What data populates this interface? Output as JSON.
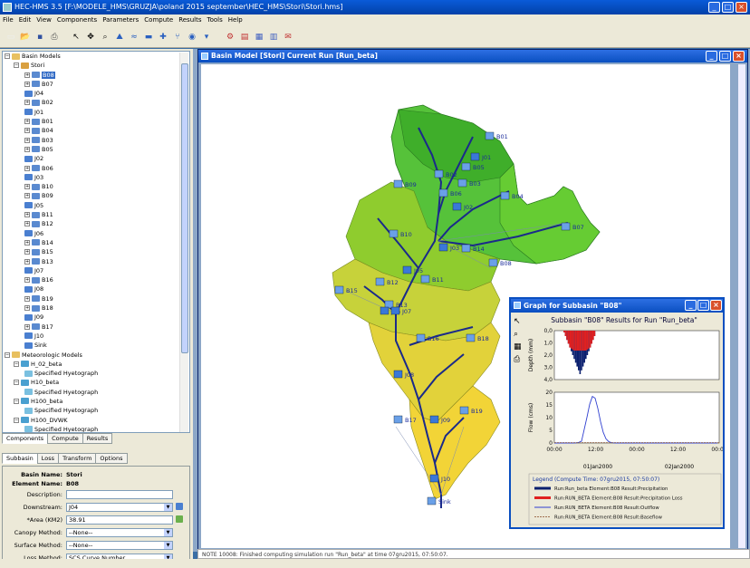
{
  "window": {
    "title": "HEC-HMS 3.5 [F:\\MODELE_HMS\\GRUZJA\\poland 2015 september\\HEC_HMS\\Stori\\Stori.hms]"
  },
  "menu": [
    "File",
    "Edit",
    "View",
    "Components",
    "Parameters",
    "Compute",
    "Results",
    "Tools",
    "Help"
  ],
  "toolbar_icons": [
    "new-icon",
    "open-icon",
    "save-icon",
    "print-icon",
    "arrow-icon",
    "pan-icon",
    "zoom-icon",
    "subbasin-icon",
    "reach-icon",
    "reservoir-icon",
    "junction-icon",
    "diversion-icon",
    "source-icon",
    "sink-icon",
    "compute-icon",
    "graph-icon",
    "summary-icon",
    "table-icon",
    "message-icon"
  ],
  "tree": {
    "root": "Basin Models",
    "basin": "Stori",
    "elements": [
      "B08",
      "B07",
      "J04",
      "B02",
      "J01",
      "B01",
      "B04",
      "B03",
      "B05",
      "J02",
      "B06",
      "J03",
      "B10",
      "B09",
      "J05",
      "B11",
      "B12",
      "J06",
      "B14",
      "B15",
      "B13",
      "J07",
      "B16",
      "J08",
      "B19",
      "B18",
      "J09",
      "B17",
      "J10",
      "Sink"
    ],
    "met_root": "Meteorologic Models",
    "met": [
      {
        "name": "H_02_beta",
        "child": "Specified Hyetograph"
      },
      {
        "name": "H10_beta",
        "child": "Specified Hyetograph"
      },
      {
        "name": "H100_beta",
        "child": "Specified Hyetograph"
      },
      {
        "name": "H100_DVWK",
        "child": "Specified Hyetograph"
      }
    ]
  },
  "left_tabs": [
    "Components",
    "Compute",
    "Results"
  ],
  "prop_tabs": [
    "Subbasin",
    "Loss",
    "Transform",
    "Options"
  ],
  "props": {
    "basin_name_label": "Basin Name:",
    "basin_name": "Stori",
    "element_name_label": "Element Name:",
    "element_name": "B08",
    "description_label": "Description:",
    "description": "",
    "downstream_label": "Downstream:",
    "downstream": "J04",
    "area_label": "*Area (KM2)",
    "area": "38.91",
    "canopy_label": "Canopy Method:",
    "canopy": "--None--",
    "surface_label": "Surface Method:",
    "surface": "--None--",
    "loss_label": "Loss Method:",
    "loss": "SCS Curve Number"
  },
  "basin_window": {
    "title": "Basin Model [Stori]  Current Run [Run_beta]"
  },
  "map_labels": [
    "B01",
    "B02",
    "B03",
    "J01",
    "B04",
    "B05",
    "B06",
    "J02",
    "B07",
    "B08",
    "B09",
    "B10",
    "J03",
    "B11",
    "J05",
    "B12",
    "B13",
    "B14",
    "B15",
    "J06",
    "J07",
    "B16",
    "B18",
    "J08",
    "B17",
    "J09",
    "B19",
    "J10",
    "Sink"
  ],
  "graph": {
    "title": "Graph for Subbasin \"B08\"",
    "plot_title": "Subbasin \"B08\" Results for Run \"Run_beta\"",
    "depth_label": "Depth (mm)",
    "flow_label": "Flow (cms)",
    "depth_ticks": [
      "0,0",
      "1,0",
      "2,0",
      "3,0",
      "4,0"
    ],
    "flow_ticks": [
      "0",
      "5",
      "10",
      "15",
      "20"
    ],
    "time_ticks": [
      "00:00",
      "12:00",
      "00:00",
      "12:00",
      "00:00"
    ],
    "date_ticks": [
      "01Jan2000",
      "02Jan2000"
    ],
    "legend_title": "Legend (Compute Time: 07gru2015, 07:50:07)",
    "legend": [
      {
        "label": "Run:Run_beta Element:B08 Result:Precipitation",
        "color": "#0a1f6e"
      },
      {
        "label": "Run:RUN_BETA Element:B08 Result:Precipitation Loss",
        "color": "#e02020"
      },
      {
        "label": "Run:RUN_BETA Element:B08 Result:Outflow",
        "color": "#3040d0"
      },
      {
        "label": "Run:RUN_BETA Element:B08 Result:Baseflow",
        "color": "#a07050"
      }
    ]
  },
  "status_text": "NOTE 10008:  Finished computing simulation run \"Run_beta\" at time 07gru2015, 07:50:07."
}
